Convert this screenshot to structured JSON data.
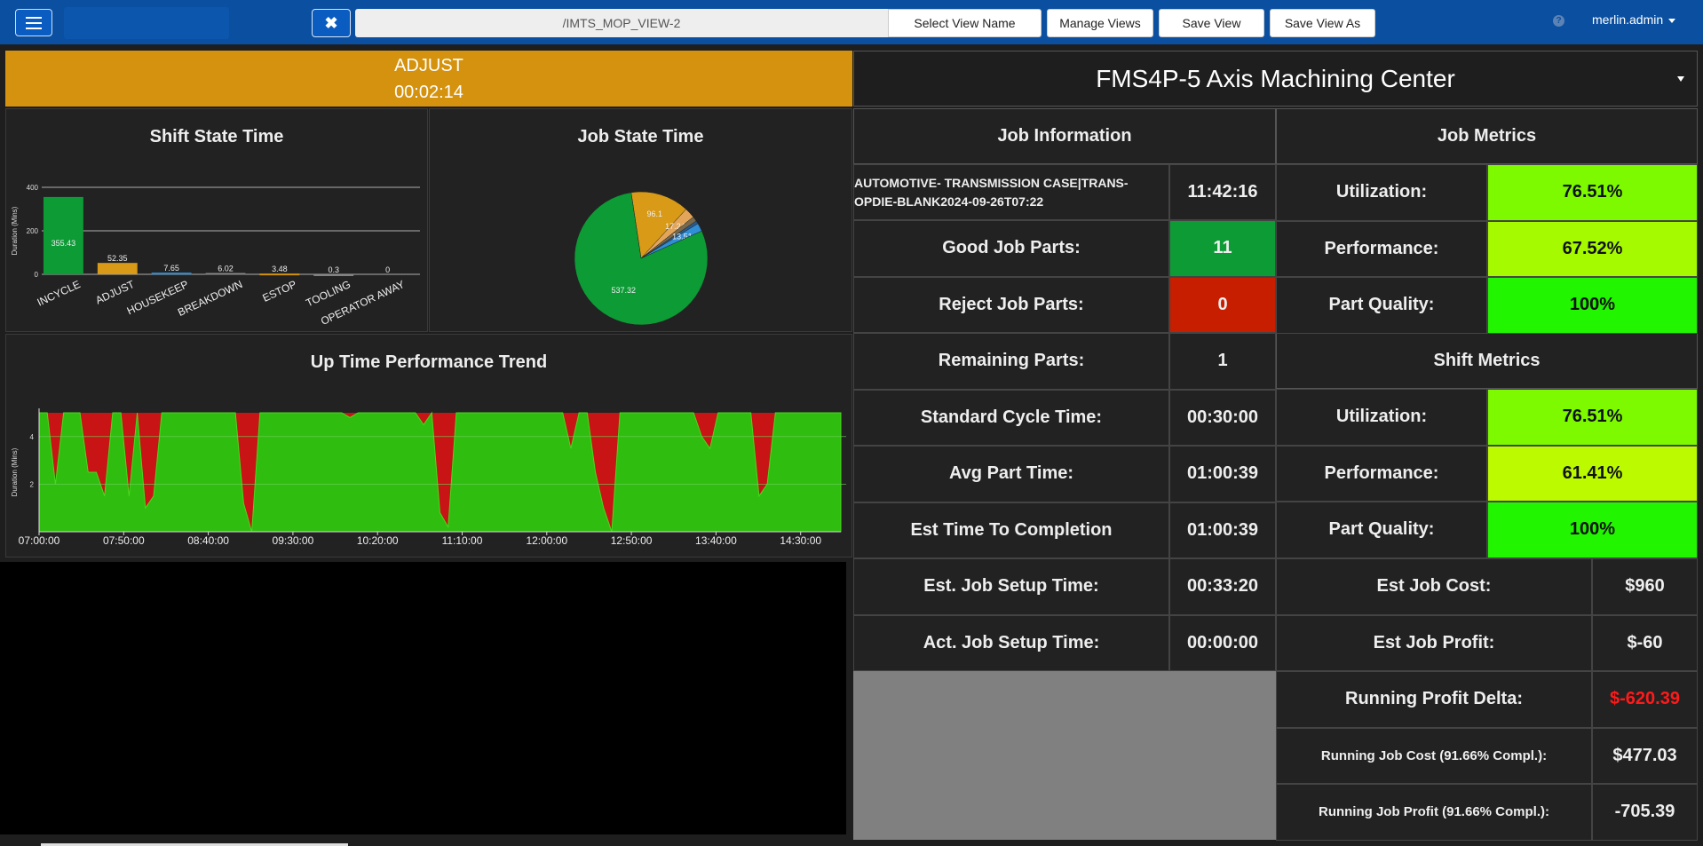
{
  "topbar": {
    "view_path": "/IMTS_MOP_VIEW-2",
    "select_view_label": "Select View Name",
    "manage_views_label": "Manage Views",
    "save_view_label": "Save View",
    "save_view_as_label": "Save View As",
    "user": "merlin.admin",
    "close_label": "✖",
    "help_label": "?"
  },
  "state_banner": {
    "state": "ADJUST",
    "duration": "00:02:14",
    "color": "#d4920e"
  },
  "machine_title": "FMS4P-5 Axis Machining Center",
  "shift_state_panel": {
    "title": "Shift State Time",
    "chart_data": {
      "type": "bar",
      "ylabel": "Duration (Mins)",
      "ylim": [
        0,
        400
      ],
      "yticks": [
        "0",
        "200",
        "400"
      ],
      "categories": [
        "INCYCLE",
        "ADJUST",
        "HOUSEKEEP",
        "BREAKDOWN",
        "ESTOP",
        "TOOLING",
        "OPERATOR AWAY"
      ],
      "values": [
        355.43,
        52.35,
        7.65,
        6.02,
        3.48,
        0.3,
        0
      ],
      "value_labels": [
        "355.43",
        "52.35",
        "7.65",
        "6.02",
        "3.48",
        "0.3",
        "0"
      ],
      "colors": [
        "#0d9b36",
        "#d89a17",
        "#2f8ed6",
        "#888888",
        "#d4920e",
        "#888888",
        "#888888"
      ],
      "grid": true
    }
  },
  "job_state_panel": {
    "title": "Job State Time",
    "chart_data": {
      "type": "pie",
      "values": [
        537.32,
        96.1,
        17.24,
        8,
        5,
        13.51
      ],
      "labels": [
        "537.32",
        "96.1",
        "17.24",
        "",
        "",
        "13.51"
      ],
      "colors": [
        "#0d9b36",
        "#d89a17",
        "#e3a55a",
        "#7a6a4a",
        "#2a5a8a",
        "#2f8ed6"
      ]
    }
  },
  "trend_panel": {
    "title": "Up Time Performance Trend",
    "chart_data": {
      "type": "area",
      "ylabel": "Duration (Mins)",
      "ylim": [
        0,
        5
      ],
      "yticks": [
        "2",
        "4"
      ],
      "xticks": [
        "07:00:00",
        "07:50:00",
        "08:40:00",
        "09:30:00",
        "10:20:00",
        "11:10:00",
        "12:00:00",
        "12:50:00",
        "13:40:00",
        "14:30:00"
      ],
      "x_start": "07:00",
      "x_end": "15:00",
      "step_minutes": 5,
      "values": [
        5,
        5,
        2,
        5,
        5,
        5,
        2.5,
        2.5,
        1.5,
        5,
        5,
        1.5,
        5,
        1,
        1.5,
        5,
        5,
        5,
        5,
        5,
        5,
        5,
        5,
        5,
        5,
        1.2,
        0,
        5,
        5,
        5,
        5,
        5,
        5,
        5,
        5,
        5,
        5,
        5,
        4.8,
        5,
        5,
        5,
        5,
        5,
        5,
        5,
        5,
        4.5,
        5,
        0.8,
        0.2,
        5,
        5,
        5,
        5,
        5,
        5,
        5,
        5,
        5,
        5,
        5,
        5,
        5,
        5,
        3.5,
        5,
        5,
        2.5,
        1,
        0,
        5,
        5,
        5,
        5,
        5,
        5,
        5,
        5,
        5,
        5,
        4,
        3.5,
        5,
        5,
        5,
        5,
        5,
        1.5,
        2,
        5,
        5,
        5,
        5,
        5,
        5,
        5,
        5,
        5
      ],
      "fill_color": "#2fbd10",
      "downtime_color": "#c81414",
      "grid": true
    }
  },
  "job_information": {
    "title": "Job Information",
    "job_name": "AUTOMOTIVE- TRANSMISSION CASE|TRANS-OPDIE-BLANK2024-09-26T07:22",
    "job_time": "11:42:16",
    "rows": [
      {
        "label": "Good Job Parts:",
        "value": "11",
        "bg": "#0d9b36"
      },
      {
        "label": "Reject Job Parts:",
        "value": "0",
        "bg": "#c81e00"
      },
      {
        "label": "Remaining Parts:",
        "value": "1",
        "bg": ""
      },
      {
        "label": "Standard Cycle Time:",
        "value": "00:30:00",
        "bg": ""
      },
      {
        "label": "Avg Part Time:",
        "value": "01:00:39",
        "bg": ""
      },
      {
        "label": "Est Time To Completion",
        "value": "01:00:39",
        "bg": ""
      },
      {
        "label": "Est. Job Setup Time:",
        "value": "00:33:20",
        "bg": ""
      },
      {
        "label": "Act. Job Setup Time:",
        "value": "00:00:00",
        "bg": ""
      }
    ]
  },
  "job_metrics": {
    "title": "Job Metrics",
    "rows": [
      {
        "label": "Utilization:",
        "value": "76.51%",
        "bg": "#7dfa00"
      },
      {
        "label": "Performance:",
        "value": "67.52%",
        "bg": "#a6fa00"
      },
      {
        "label": "Part Quality:",
        "value": "100%",
        "bg": "#22f500"
      }
    ]
  },
  "shift_metrics": {
    "title": "Shift Metrics",
    "rows": [
      {
        "label": "Utilization:",
        "value": "76.51%",
        "bg": "#7dfa00"
      },
      {
        "label": "Performance:",
        "value": "61.41%",
        "bg": "#bcfa00"
      },
      {
        "label": "Part Quality:",
        "value": "100%",
        "bg": "#22f500"
      }
    ]
  },
  "financials": {
    "rows": [
      {
        "label": "Est Job Cost:",
        "value": "$960",
        "color": "#eeeeee"
      },
      {
        "label": "Est Job Profit:",
        "value": "$-60",
        "color": "#eeeeee"
      },
      {
        "label": "Running Profit Delta:",
        "value": "$-620.39",
        "color": "#ff1a1a"
      },
      {
        "label": "Running Job Cost (91.66% Compl.):",
        "value": "$477.03",
        "color": "#eeeeee"
      },
      {
        "label": "Running Job Profit (91.66% Compl.):",
        "value": "-705.39",
        "color": "#eeeeee"
      }
    ]
  }
}
